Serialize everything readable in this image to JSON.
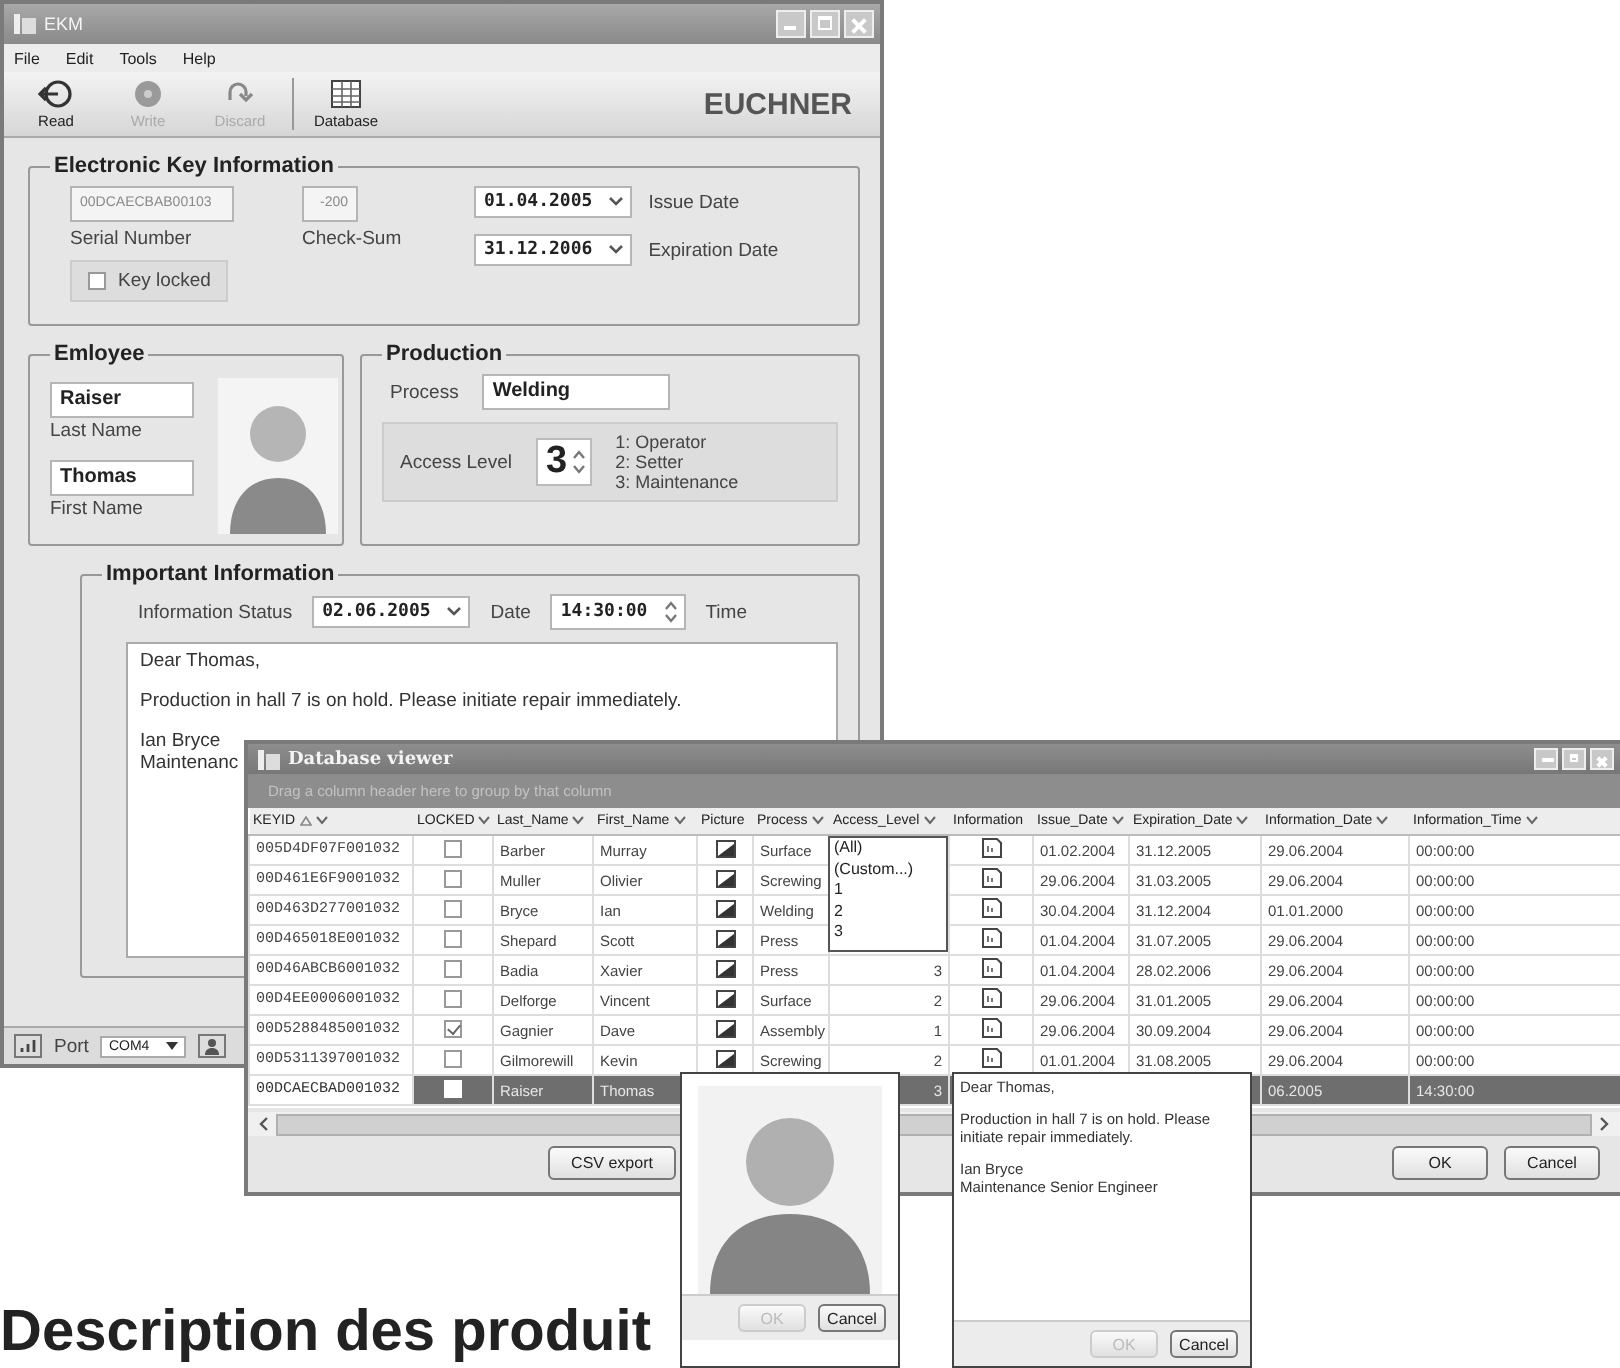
{
  "ekm_window": {
    "title": "EKM",
    "menu": [
      {
        "label": "File"
      },
      {
        "label": "Edit"
      },
      {
        "label": "Tools"
      },
      {
        "label": "Help"
      }
    ],
    "toolbar": [
      {
        "label": "Read",
        "kind": "read",
        "disabled": false
      },
      {
        "label": "Write",
        "kind": "write",
        "disabled": true
      },
      {
        "label": "Discard",
        "kind": "discard",
        "disabled": true
      },
      {
        "label": "Database",
        "kind": "database",
        "disabled": false
      }
    ],
    "logo": "EUCHNER",
    "key_info": {
      "title": "Electronic Key Information",
      "serial_number": {
        "value": "00DCAECBAB00103",
        "label": "Serial Number",
        "disabled": true
      },
      "check_sum": {
        "value": "-200",
        "label": "Check-Sum",
        "disabled": true
      },
      "key_locked": {
        "label": "Key locked",
        "checked": false
      },
      "issue_date": {
        "value": "01.04.2005",
        "label": "Issue Date"
      },
      "expiration_date": {
        "value": "31.12.2006",
        "label": "Expiration Date"
      }
    },
    "employee": {
      "title": "Emloyee",
      "last_name": {
        "value": "Raiser",
        "label": "Last Name"
      },
      "first_name": {
        "value": "Thomas",
        "label": "First Name"
      }
    },
    "production": {
      "title": "Production",
      "process": {
        "label": "Process",
        "value": "Welding"
      },
      "access_level": {
        "label": "Access Level",
        "value": "3",
        "legend": [
          "1: Operator",
          "2: Setter",
          "3: Maintenance"
        ]
      }
    },
    "important_info": {
      "title": "Important Information",
      "status_label": "Information Status",
      "date": {
        "value": "02.06.2005",
        "label": "Date"
      },
      "time": {
        "value": "14:30:00",
        "label": "Time"
      },
      "message_lines": [
        "Dear Thomas,",
        "Production in hall 7 is on hold. Please initiate repair immediately.",
        "Ian Bryce",
        "Maintenanc"
      ]
    },
    "status_bar": {
      "port_label": "Port",
      "port_value": "COM4"
    }
  },
  "database_viewer": {
    "title": "Database viewer",
    "group_hint": "Drag a column header here to group by that column",
    "columns": [
      {
        "label": "KEYID",
        "sorted": true,
        "filter": true
      },
      {
        "label": "LOCKED",
        "sorted": false,
        "filter": true
      },
      {
        "label": "Last_Name",
        "sorted": false,
        "filter": true
      },
      {
        "label": "First_Name",
        "sorted": false,
        "filter": true
      },
      {
        "label": "Picture",
        "sorted": false,
        "filter": false
      },
      {
        "label": "Process",
        "sorted": false,
        "filter": true
      },
      {
        "label": "Access_Level",
        "sorted": false,
        "filter": true
      },
      {
        "label": "Information",
        "sorted": false,
        "filter": false
      },
      {
        "label": "Issue_Date",
        "sorted": false,
        "filter": true
      },
      {
        "label": "Expiration_Date",
        "sorted": false,
        "filter": true
      },
      {
        "label": "Information_Date",
        "sorted": false,
        "filter": true
      },
      {
        "label": "Information_Time",
        "sorted": false,
        "filter": true
      }
    ],
    "rows": [
      {
        "keyid": "005D4DF07F001032",
        "locked": false,
        "last_name": "Barber",
        "first_name": "Murray",
        "picture": true,
        "process": "Surface",
        "information": true,
        "issue_date": "01.02.2004",
        "expiration_date": "31.12.2005",
        "information_date": "29.06.2004",
        "information_time": "00:00:00",
        "selected": false
      },
      {
        "keyid": "00D461E6F9001032",
        "locked": false,
        "last_name": "Muller",
        "first_name": "Olivier",
        "picture": true,
        "process": "Screwing",
        "information": true,
        "issue_date": "29.06.2004",
        "expiration_date": "31.03.2005",
        "information_date": "29.06.2004",
        "information_time": "00:00:00",
        "selected": false
      },
      {
        "keyid": "00D463D277001032",
        "locked": false,
        "last_name": "Bryce",
        "first_name": "Ian",
        "picture": true,
        "process": "Welding",
        "information": true,
        "issue_date": "30.04.2004",
        "expiration_date": "31.12.2004",
        "information_date": "01.01.2000",
        "information_time": "00:00:00",
        "selected": false
      },
      {
        "keyid": "00D465018E001032",
        "locked": false,
        "last_name": "Shepard",
        "first_name": "Scott",
        "picture": true,
        "process": "Press",
        "information": true,
        "issue_date": "01.04.2004",
        "expiration_date": "31.07.2005",
        "information_date": "29.06.2004",
        "information_time": "00:00:00",
        "selected": false
      },
      {
        "keyid": "00D46ABCB6001032",
        "locked": false,
        "last_name": "Badia",
        "first_name": "Xavier",
        "picture": true,
        "process": "Press",
        "access_level": "3",
        "information": true,
        "issue_date": "01.04.2004",
        "expiration_date": "28.02.2006",
        "information_date": "29.06.2004",
        "information_time": "00:00:00",
        "selected": false
      },
      {
        "keyid": "00D4EE0006001032",
        "locked": false,
        "last_name": "Delforge",
        "first_name": "Vincent",
        "picture": true,
        "process": "Surface",
        "access_level": "2",
        "information": true,
        "issue_date": "29.06.2004",
        "expiration_date": "31.01.2005",
        "information_date": "29.06.2004",
        "information_time": "00:00:00",
        "selected": false
      },
      {
        "keyid": "00D5288485001032",
        "locked": true,
        "last_name": "Gagnier",
        "first_name": "Dave",
        "picture": true,
        "process": "Assembly",
        "access_level": "1",
        "information": true,
        "issue_date": "29.06.2004",
        "expiration_date": "30.09.2004",
        "information_date": "29.06.2004",
        "information_time": "00:00:00",
        "selected": false
      },
      {
        "keyid": "00D5311397001032",
        "locked": false,
        "last_name": "Gilmorewill",
        "first_name": "Kevin",
        "picture": true,
        "process": "Screwing",
        "access_level": "2",
        "information": true,
        "issue_date": "01.01.2004",
        "expiration_date": "31.08.2005",
        "information_date": "29.06.2004",
        "information_time": "00:00:00",
        "selected": false
      },
      {
        "keyid": "00DCAECBAD001032",
        "locked": false,
        "last_name": "Raiser",
        "first_name": "Thomas",
        "picture": false,
        "access_level": "3",
        "information": false,
        "information_date": "06.2005",
        "information_time": "14:30:00",
        "selected": true
      }
    ],
    "access_filter": [
      "(All)",
      "(Custom...)",
      "1",
      "2",
      "3"
    ],
    "buttons": [
      {
        "label": "CSV export",
        "kind": "export"
      },
      {
        "label": "OK",
        "kind": "ok"
      },
      {
        "label": "Cancel",
        "kind": "cancel"
      }
    ]
  },
  "picture_popup": {
    "buttons": [
      {
        "label": "OK",
        "disabled": true
      },
      {
        "label": "Cancel",
        "disabled": false
      }
    ]
  },
  "info_popup": {
    "paragraphs": [
      "Dear Thomas,",
      "Production in hall 7 is on hold. Please initiate repair immediately.",
      "Ian Bryce",
      "Maintenance Senior Engineer"
    ],
    "buttons": [
      {
        "label": "OK",
        "disabled": true
      },
      {
        "label": "Cancel",
        "disabled": false
      }
    ]
  },
  "page_heading": "Description des produit"
}
